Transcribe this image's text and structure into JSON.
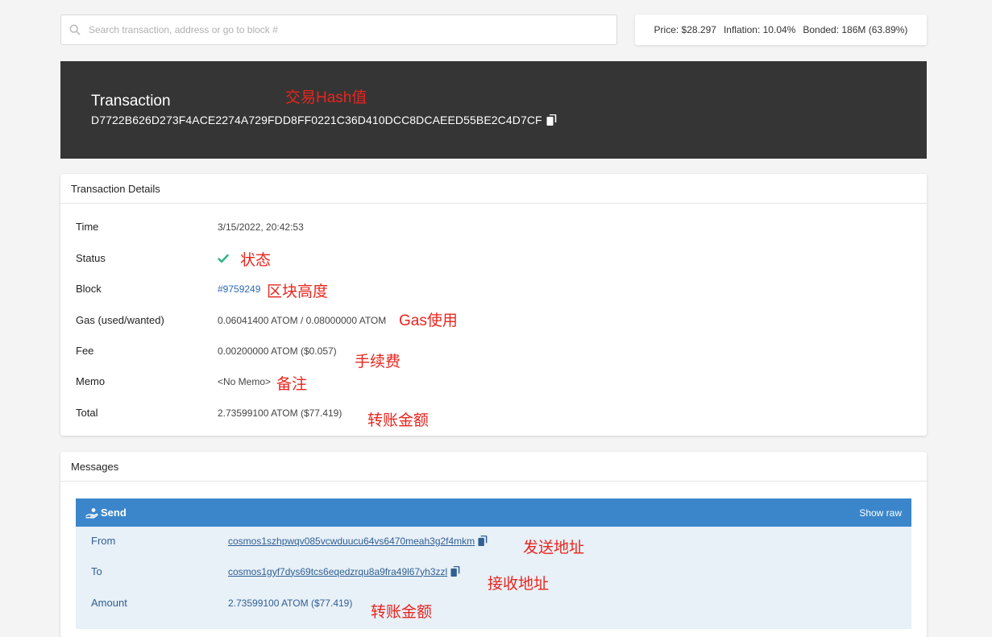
{
  "search": {
    "placeholder": "Search transaction, address or go to block #"
  },
  "stats": {
    "price": "Price: $28.297",
    "inflation": "Inflation: 10.04%",
    "bonded": "Bonded: 186M (63.89%)"
  },
  "transaction": {
    "title": "Transaction",
    "hash": "D7722B626D273F4ACE2274A729FDD8FF0221C36D410DCC8DCAEED55BE2C4D7CF",
    "annotation": "交易Hash值"
  },
  "details": {
    "header": "Transaction Details",
    "rows": [
      {
        "label": "Time",
        "value": "3/15/2022, 20:42:53",
        "annotation": ""
      },
      {
        "label": "Status",
        "value": "",
        "annotation": "状态"
      },
      {
        "label": "Block",
        "value": "#9759249",
        "annotation": "区块高度"
      },
      {
        "label": "Gas (used/wanted)",
        "value": "0.06041400 ATOM / 0.08000000 ATOM",
        "annotation": "Gas使用"
      },
      {
        "label": "Fee",
        "value": "0.00200000 ATOM ($0.057)",
        "annotation": "手续费"
      },
      {
        "label": "Memo",
        "value": "<No Memo>",
        "annotation": "备注"
      },
      {
        "label": "Total",
        "value": "2.73599100 ATOM ($77.419)",
        "annotation": "转账金额"
      }
    ]
  },
  "messages": {
    "header": "Messages",
    "send_label": "Send",
    "show_raw": "Show raw",
    "rows": [
      {
        "label": "From",
        "value": "cosmos1szhpwqv085vcwduucu64vs6470meah3g2f4mkm",
        "annotation": "发送地址"
      },
      {
        "label": "To",
        "value": "cosmos1gyf7dys69tcs6eqedzrqu8a9fra49l67yh3zzl",
        "annotation": "接收地址"
      },
      {
        "label": "Amount",
        "value": "2.73599100 ATOM ($77.419)",
        "annotation": "转账金额"
      }
    ]
  },
  "colors": {
    "accent": "#3b86cb",
    "annotation": "#e8251d",
    "hero_bg": "#353535",
    "success": "#2fb380"
  }
}
